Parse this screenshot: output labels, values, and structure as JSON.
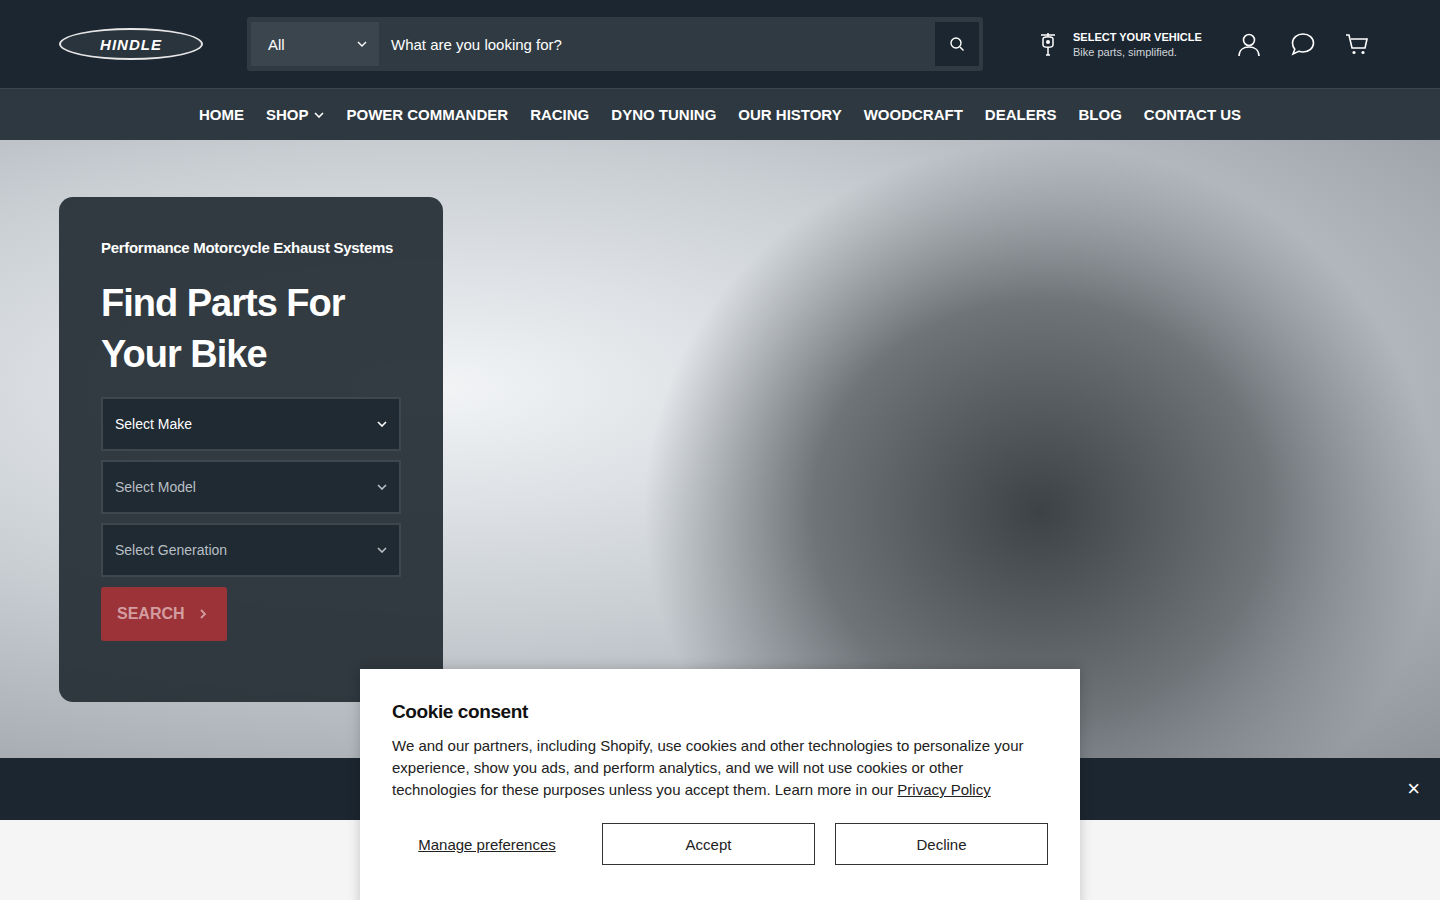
{
  "header": {
    "logo": "HINDLE",
    "category": "All",
    "search_placeholder": "What are you looking for?",
    "vehicle_title": "SELECT YOUR VEHICLE",
    "vehicle_subtitle": "Bike parts, simplified."
  },
  "nav": [
    {
      "label": "HOME",
      "has_dropdown": false
    },
    {
      "label": "SHOP",
      "has_dropdown": true
    },
    {
      "label": "POWER COMMANDER",
      "has_dropdown": false
    },
    {
      "label": "RACING",
      "has_dropdown": false
    },
    {
      "label": "DYNO TUNING",
      "has_dropdown": false
    },
    {
      "label": "OUR HISTORY",
      "has_dropdown": false
    },
    {
      "label": "WOODCRAFT",
      "has_dropdown": false
    },
    {
      "label": "DEALERS",
      "has_dropdown": false
    },
    {
      "label": "BLOG",
      "has_dropdown": false
    },
    {
      "label": "CONTACT US",
      "has_dropdown": false
    }
  ],
  "hero": {
    "subtitle": "Performance Motorcycle Exhaust Systems",
    "title": "Find Parts For Your Bike",
    "selects": [
      {
        "label": "Select Make",
        "disabled": false
      },
      {
        "label": "Select Model",
        "disabled": true
      },
      {
        "label": "Select Generation",
        "disabled": true
      }
    ],
    "search_button": {
      "label": "SEARCH",
      "disabled": true
    }
  },
  "strip": {
    "close": "×"
  },
  "cookie": {
    "title": "Cookie consent",
    "text": "We and our partners, including Shopify, use cookies and other technologies to personalize your experience, show you ads, and perform analytics, and we will not use cookies or other technologies for these purposes unless you accept them. Learn more in our ",
    "link": "Privacy Policy",
    "manage": "Manage preferences",
    "buttons": [
      "Accept",
      "Decline"
    ]
  }
}
